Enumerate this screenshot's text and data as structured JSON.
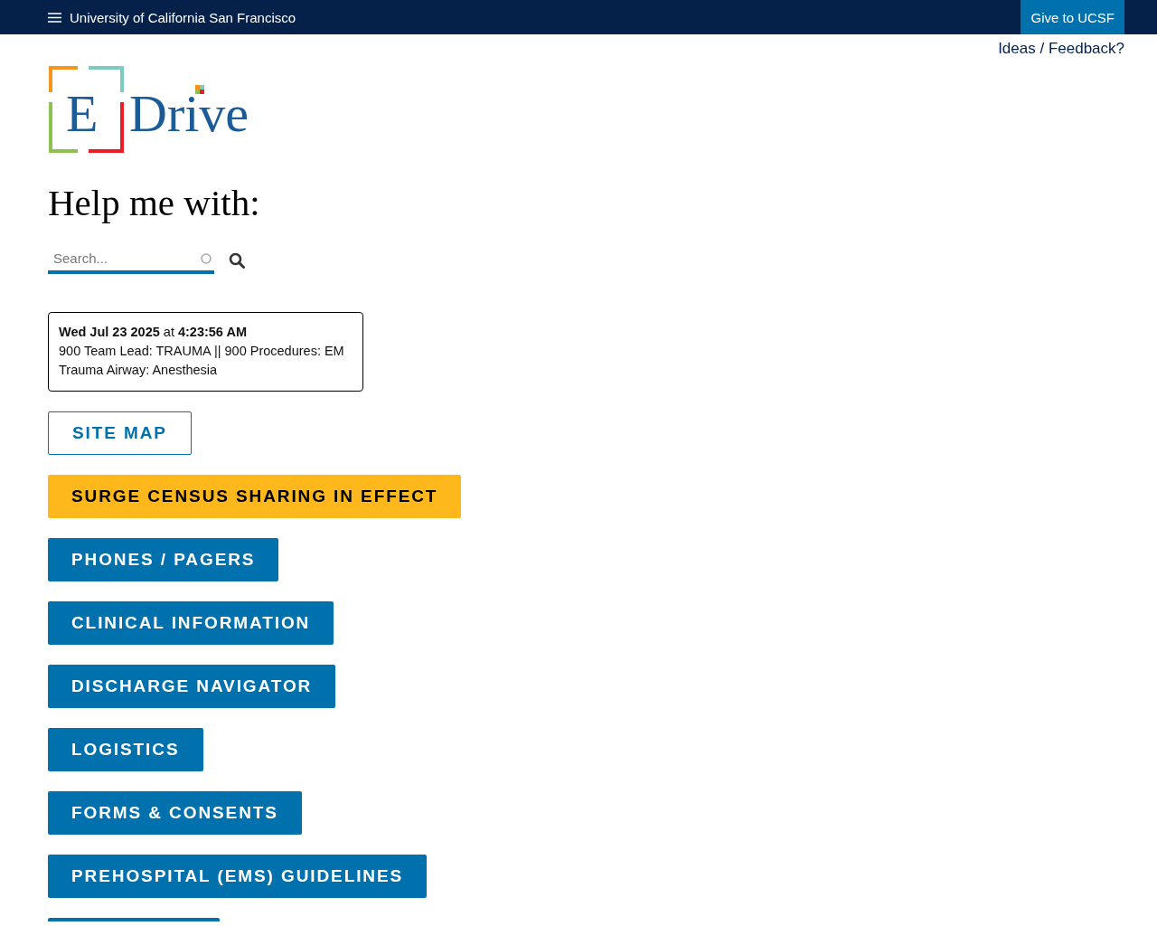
{
  "top_bar": {
    "title": "University of California San Francisco",
    "give_button": "Give to UCSF"
  },
  "feedback_link": "Ideas / Feedback?",
  "logo": {
    "letter": "E",
    "word": "Drive"
  },
  "heading": "Help me with:",
  "search": {
    "placeholder": "Search..."
  },
  "notice": {
    "date": "Wed Jul 23 2025",
    "at": "at",
    "time": "4:23:56 AM",
    "lines": [
      "900 Team Lead: TRAUMA || 900 Procedures: EM",
      "Trauma Airway: Anesthesia"
    ]
  },
  "buttons": [
    {
      "label": "SITE MAP",
      "kind": "outline"
    },
    {
      "label": "SURGE CENSUS SHARING IN EFFECT",
      "kind": "warning"
    },
    {
      "label": "PHONES / PAGERS",
      "kind": "primary"
    },
    {
      "label": "CLINICAL INFORMATION",
      "kind": "primary"
    },
    {
      "label": "DISCHARGE NAVIGATOR",
      "kind": "primary"
    },
    {
      "label": "LOGISTICS",
      "kind": "primary"
    },
    {
      "label": "FORMS & CONSENTS",
      "kind": "primary"
    },
    {
      "label": "PREHOSPITAL (EMS) GUIDELINES",
      "kind": "primary"
    }
  ]
}
